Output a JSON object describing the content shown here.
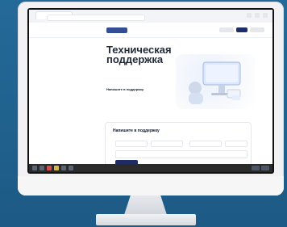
{
  "screen": {
    "heading": "Техническая поддержка",
    "contacts_heading": "Напишите в поддержку",
    "form_title": "Напишите в поддержку"
  },
  "colors": {
    "background": "#1f5f8b",
    "primary": "#1f2d67",
    "text": "#1f2937"
  },
  "icons": {
    "hero": "support-illustration",
    "window_controls": "window-controls"
  }
}
